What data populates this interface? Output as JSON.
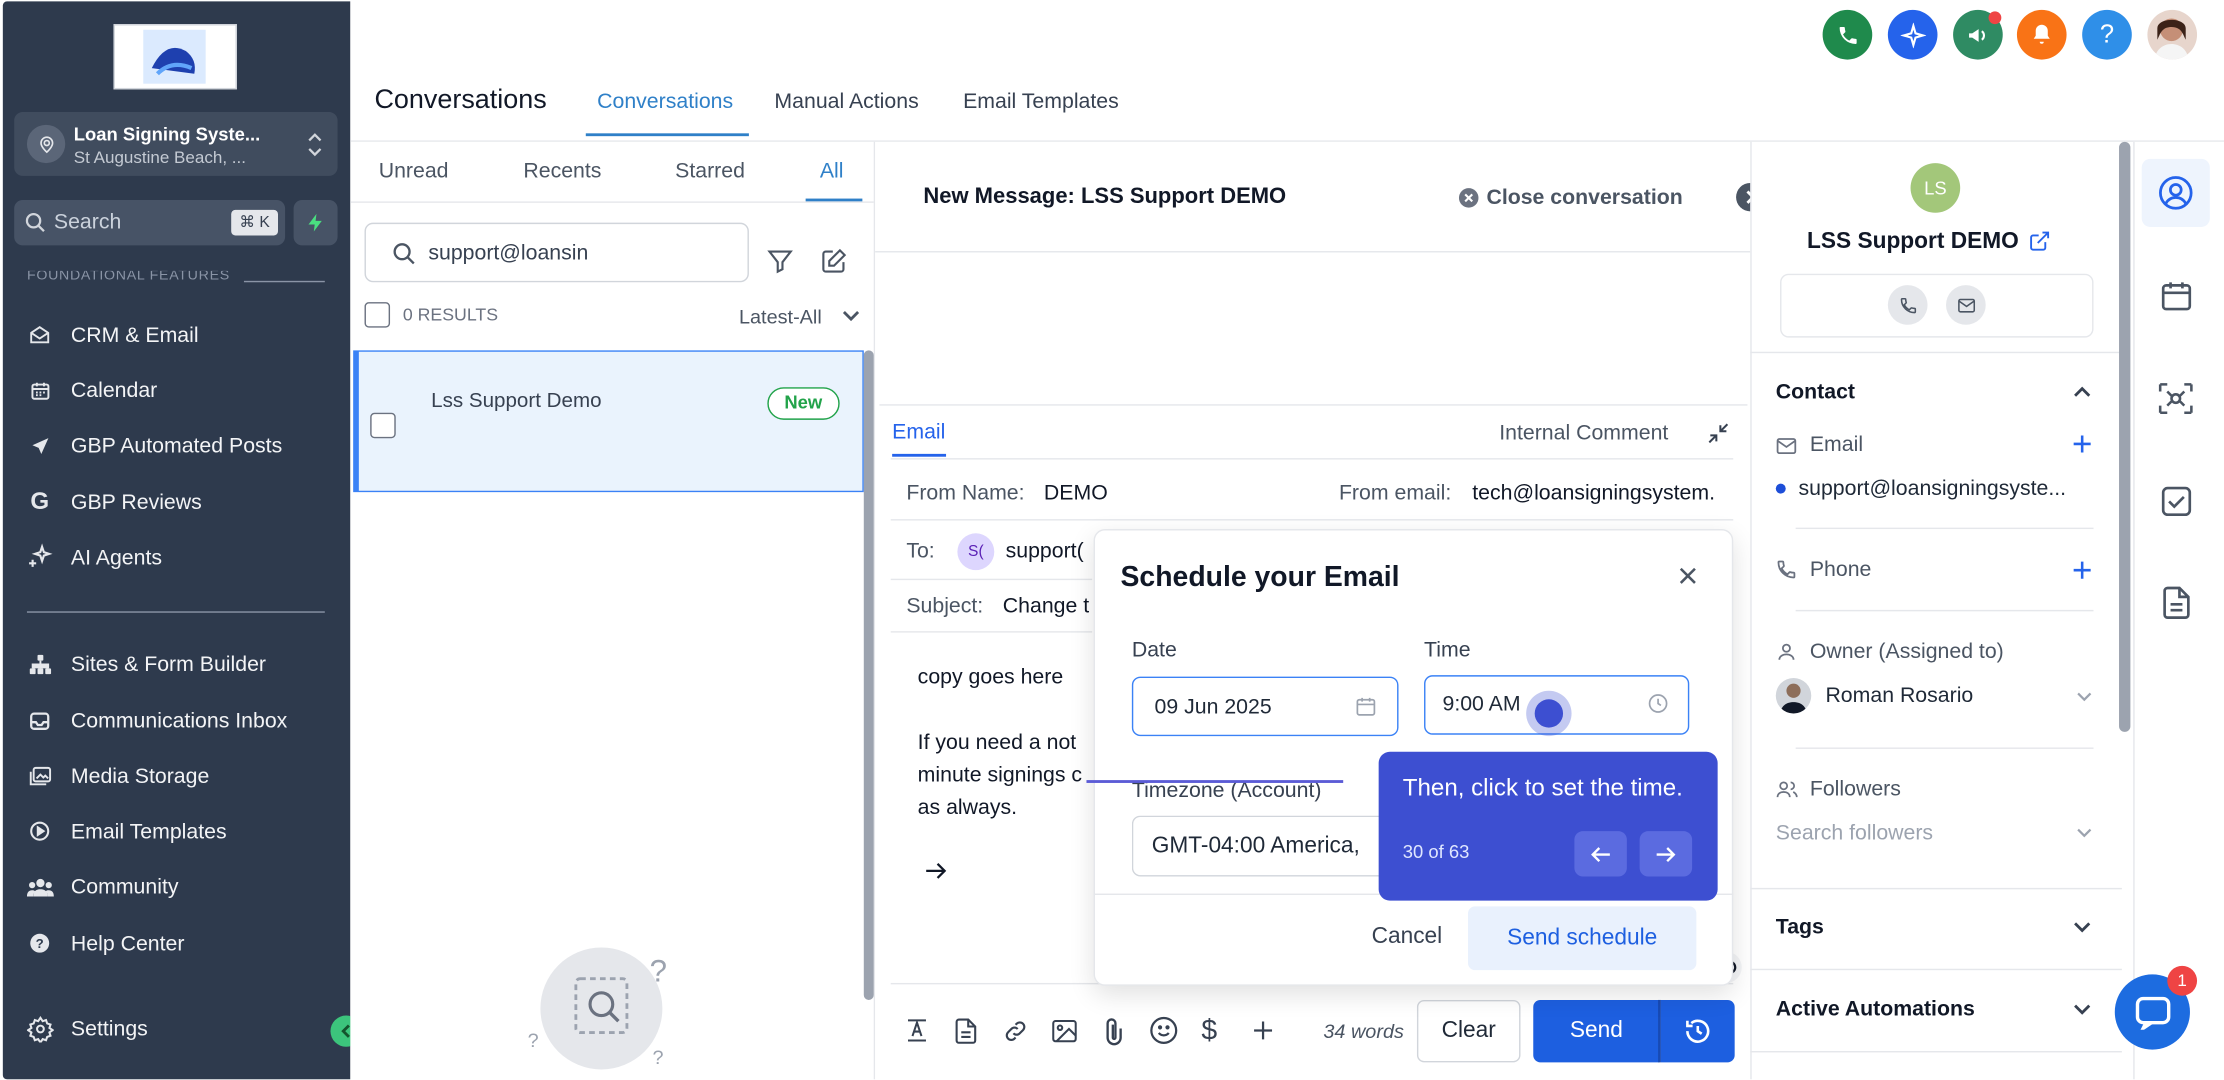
{
  "sidebar": {
    "location_name": "Loan Signing Syste...",
    "location_sub": "St Augustine Beach, ...",
    "search_placeholder": "Search",
    "search_shortcut": "⌘ K",
    "section_label": "FOUNDATIONAL FEATURES",
    "items": [
      {
        "label": "CRM & Email",
        "icon": "inbox-icon"
      },
      {
        "label": "Calendar",
        "icon": "calendar-icon"
      },
      {
        "label": "GBP Automated Posts",
        "icon": "send-icon"
      },
      {
        "label": "GBP Reviews",
        "icon": "google-icon"
      },
      {
        "label": "AI Agents",
        "icon": "sparkle-icon"
      },
      {
        "label": "Sites & Form Builder",
        "icon": "sitemap-icon"
      },
      {
        "label": "Communications Inbox",
        "icon": "inbox-tray-icon"
      },
      {
        "label": "Media Storage",
        "icon": "image-icon"
      },
      {
        "label": "Email Templates",
        "icon": "play-circle-icon"
      },
      {
        "label": "Community",
        "icon": "users-icon"
      },
      {
        "label": "Help Center",
        "icon": "help-circle-icon"
      }
    ],
    "settings_label": "Settings"
  },
  "header": {
    "title": "Conversations",
    "tabs": [
      "Conversations",
      "Manual Actions",
      "Email Templates"
    ],
    "active_tab": "Conversations"
  },
  "list": {
    "filters": [
      "Unread",
      "Recents",
      "Starred",
      "All"
    ],
    "active_filter": "All",
    "search_value": "support@loansin",
    "results": "0 RESULTS",
    "sort": "Latest-All",
    "conversation_name": "Lss Support Demo",
    "badge": "New"
  },
  "conversation": {
    "title": "New Message: LSS Support DEMO",
    "close_label": "Close conversation"
  },
  "compose": {
    "tab_email": "Email",
    "tab_internal": "Internal Comment",
    "from_name_label": "From Name:",
    "from_name_value": "DEMO",
    "from_email_label": "From email:",
    "from_email_value": "tech@loansigningsystem.",
    "to_label": "To:",
    "to_avatar": "S(",
    "to_value": "support(",
    "subject_label": "Subject:",
    "subject_value": "Change t",
    "body_line1": "copy goes here",
    "body_line2": "If you need a not",
    "body_line3": "minute signings c",
    "body_line4": "as always.",
    "word_count": "34 words",
    "clear_label": "Clear",
    "send_label": "Send"
  },
  "schedule_modal": {
    "title": "Schedule your Email",
    "date_label": "Date",
    "date_value": "09 Jun 2025",
    "time_label": "Time",
    "time_value": "9:00 AM",
    "timezone_label": "Timezone (Account)",
    "timezone_value": "GMT-04:00 America,",
    "cancel_label": "Cancel",
    "send_schedule_label": "Send schedule"
  },
  "tooltip": {
    "text": "Then, click to set the time.",
    "progress": "30 of 63",
    "step": 30,
    "total": 63
  },
  "contact": {
    "initials": "LS",
    "name": "LSS Support DEMO",
    "section_contact": "Contact",
    "email_label": "Email",
    "email_value": "support@loansigningsyste...",
    "phone_label": "Phone",
    "owner_label": "Owner (Assigned to)",
    "owner_value": "Roman Rosario",
    "followers_label": "Followers",
    "followers_placeholder": "Search followers",
    "tags_label": "Tags",
    "automations_label": "Active Automations"
  },
  "chat_widget": {
    "badge": "1"
  },
  "colors": {
    "sidebar_bg": "#2e3a4d",
    "accent_blue": "#1d5fe0",
    "tab_blue": "#2f80c8",
    "tooltip_bg": "#3d4fd1",
    "phone_green": "#1f8a4c",
    "new_badge_green": "#22a34a",
    "bell_orange": "#f97316"
  }
}
